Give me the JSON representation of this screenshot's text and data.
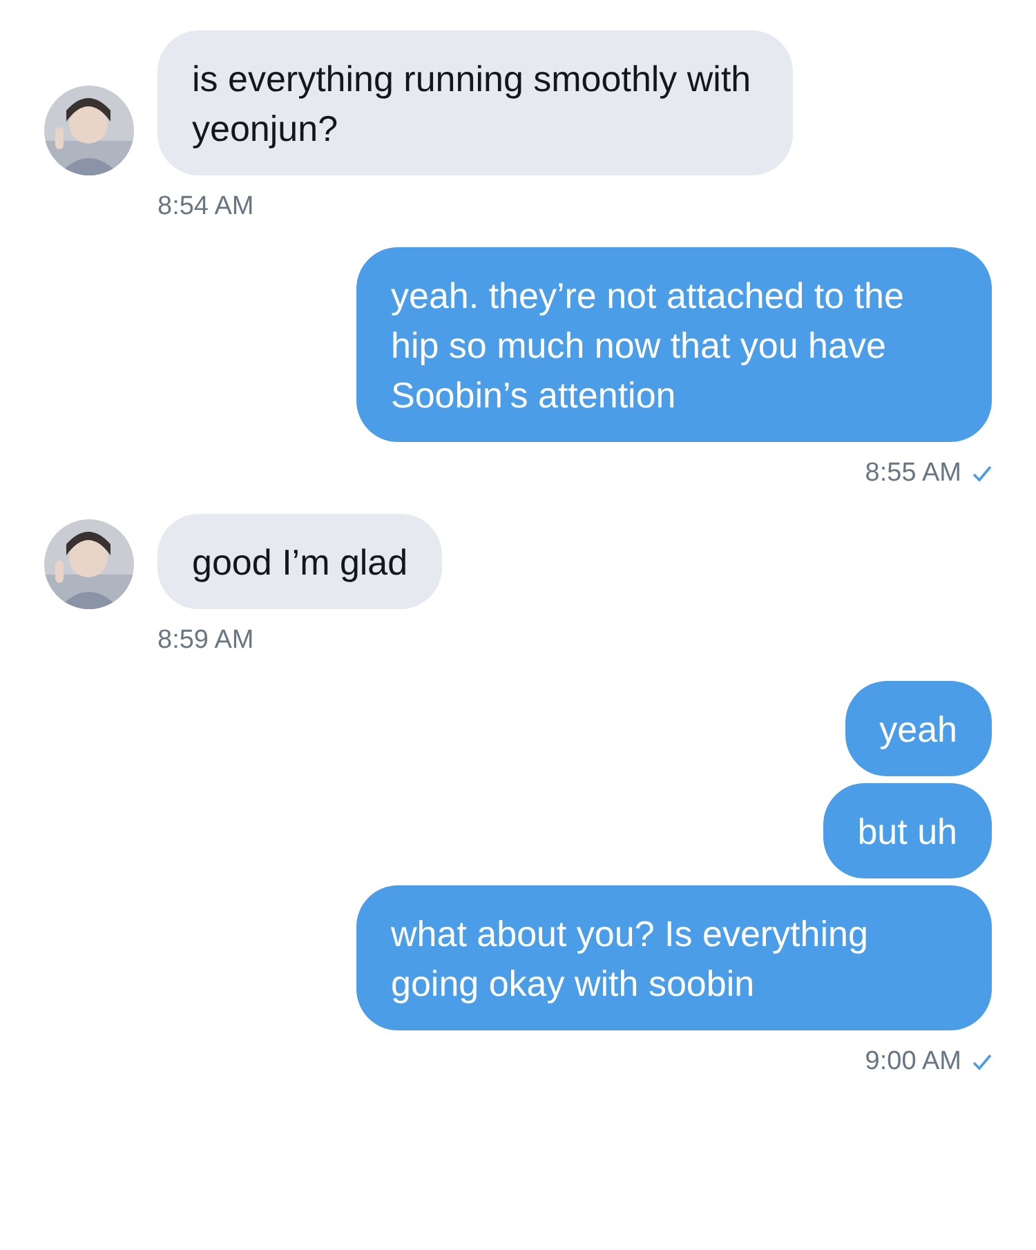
{
  "messages": [
    {
      "kind": "received",
      "bubbles": [
        "is everything running smoothly with yeonjun?"
      ],
      "time": "8:54 AM"
    },
    {
      "kind": "sent",
      "bubbles": [
        "yeah. they’re not attached to the hip so much now that you have Soobin’s attention"
      ],
      "time": "8:55 AM",
      "seen": true
    },
    {
      "kind": "received",
      "bubbles": [
        "good I’m glad"
      ],
      "time": "8:59 AM"
    },
    {
      "kind": "sent",
      "bubbles": [
        "yeah",
        "but uh",
        "what about you? Is everything going okay with soobin"
      ],
      "time": "9:00 AM",
      "seen": true
    }
  ]
}
